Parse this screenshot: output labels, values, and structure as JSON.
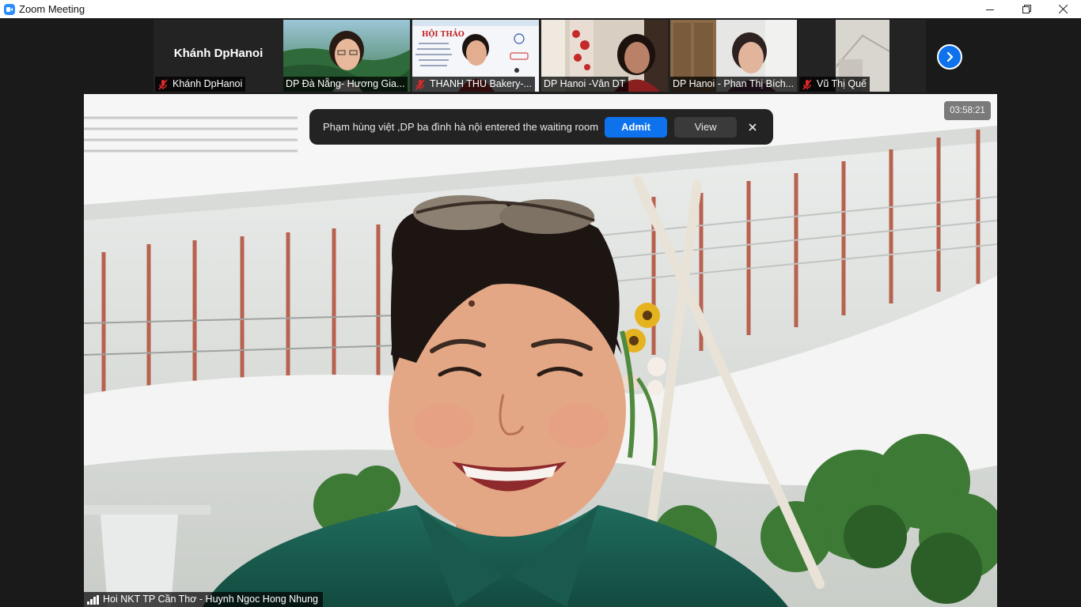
{
  "window": {
    "title": "Zoom Meeting"
  },
  "strip": {
    "self": {
      "display_name": "Khánh DpHanoi",
      "label": "Khánh DpHanoi",
      "muted": true
    },
    "participants": [
      {
        "label": "DP Đà Nẵng- Hương Gia...",
        "muted": false,
        "slide_title": ""
      },
      {
        "label": "THANH THU Bakery-...",
        "muted": true,
        "slide_title": "HỘI THẢO"
      },
      {
        "label": "DP Hanoi -Vân DT",
        "muted": false,
        "slide_title": ""
      },
      {
        "label": "DP Hanoi - Phan Thị Bích...",
        "muted": false,
        "slide_title": ""
      },
      {
        "label": "Vũ Thị Quế",
        "muted": true,
        "slide_title": ""
      }
    ],
    "next_icon": "chevron-right-icon"
  },
  "notification": {
    "message": "Phạm hùng việt ,DP ba đình hà nội entered the waiting room",
    "admit_label": "Admit",
    "view_label": "View"
  },
  "main_video": {
    "timer": "03:58:21",
    "speaker_name": "Hoi NKT TP Cần Thơ - Huynh Ngoc Hong Nhung"
  },
  "colors": {
    "accent": "#0e72ed",
    "muted_mic": "#e02828"
  }
}
